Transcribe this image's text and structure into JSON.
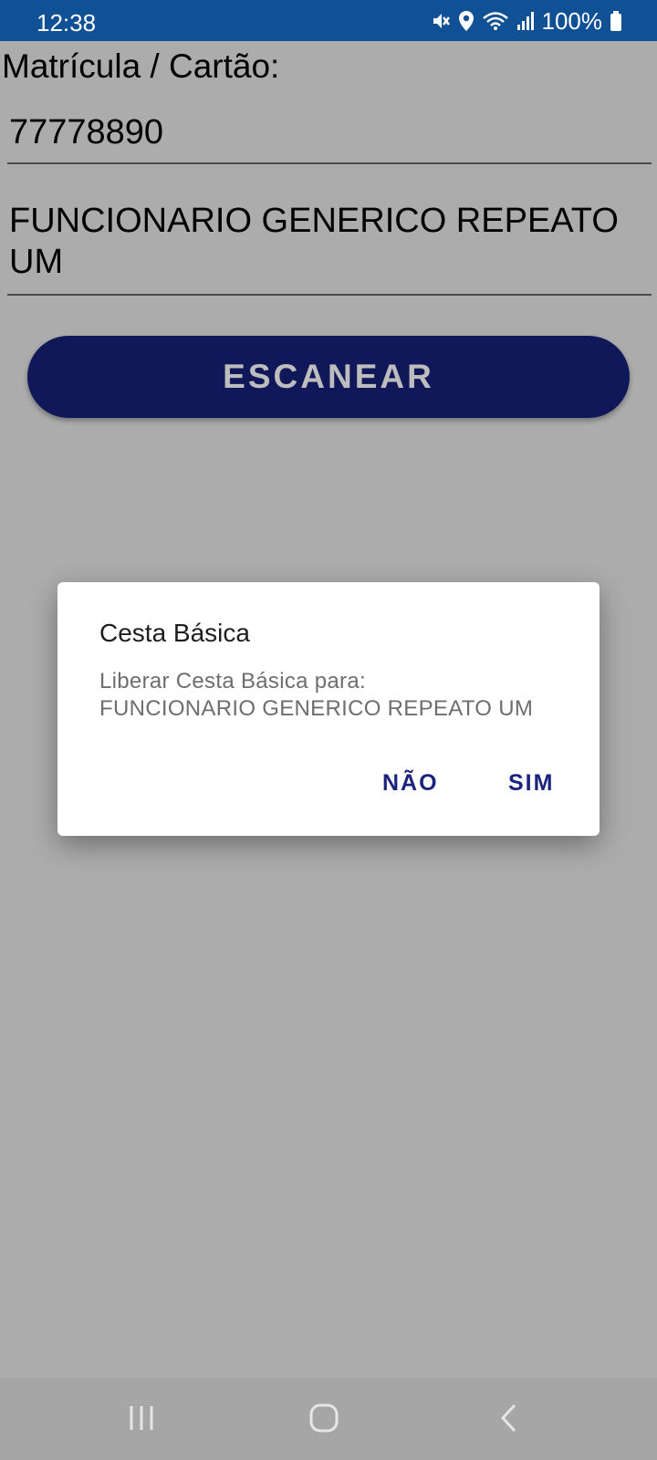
{
  "status_bar": {
    "time": "12:38",
    "battery": "100%",
    "icons": [
      "mute-icon",
      "location-icon",
      "wifi-icon",
      "signal-icon",
      "battery-icon"
    ]
  },
  "form": {
    "label": "Matrícula / Cartão:",
    "code_value": "77778890",
    "name_line1": "FUNCIONARIO GENERICO REPEATO",
    "name_line2": "UM",
    "scan_button": "ESCANEAR"
  },
  "dialog": {
    "title": "Cesta Básica",
    "message_line1": "Liberar Cesta Básica para:",
    "message_line2": "FUNCIONARIO GENERICO REPEATO UM",
    "negative_button": "NÃO",
    "positive_button": "SIM"
  },
  "nav_bar": {
    "items": [
      "recents-icon",
      "home-icon",
      "back-icon"
    ]
  },
  "colors": {
    "status_bar": "#0f5194",
    "button": "#10185a",
    "dialog_action": "#1a237e"
  }
}
